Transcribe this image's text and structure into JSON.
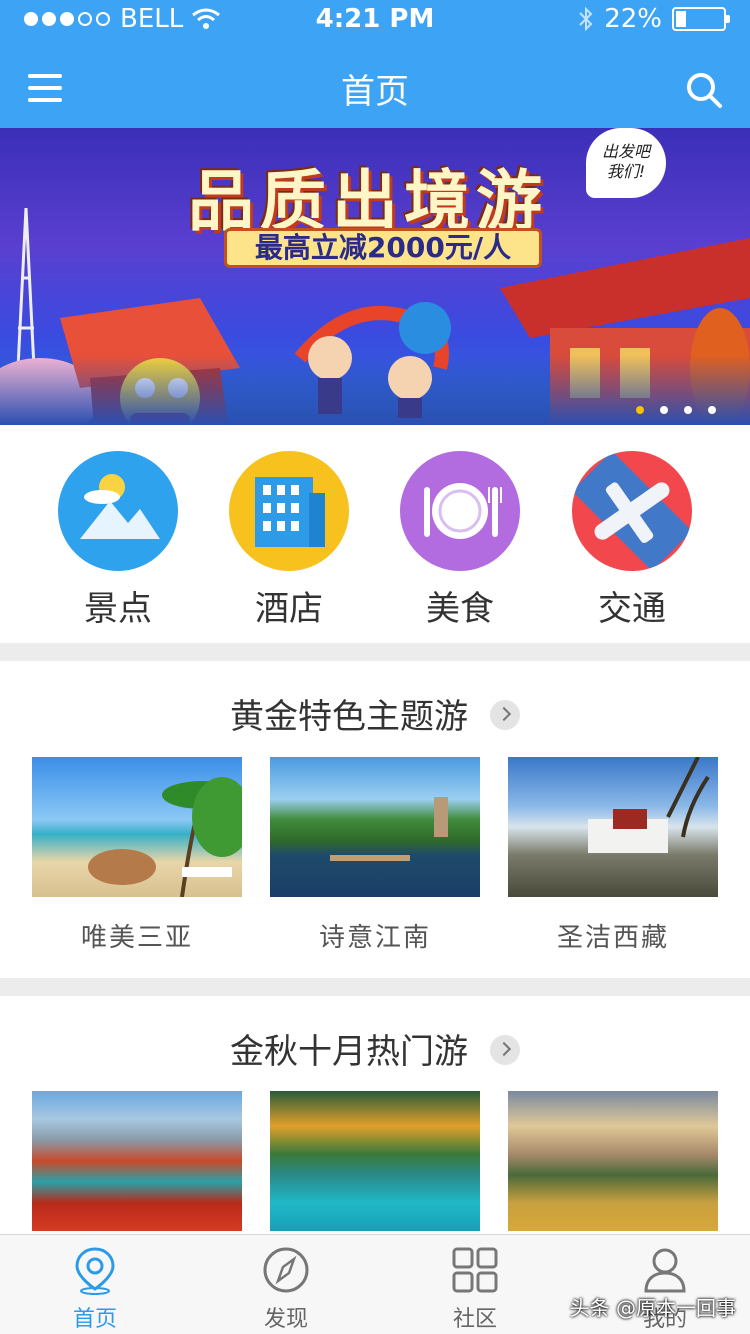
{
  "status_bar": {
    "carrier": "BELL",
    "time": "4:21 PM",
    "battery": "22%",
    "battery_level": 0.22
  },
  "nav": {
    "title": "首页"
  },
  "banner": {
    "title": "品质出境游",
    "subtitle": "最高立减2000元/人",
    "bubble_line1": "出发吧",
    "bubble_line2": "我们!",
    "page_count": 4,
    "active_page": 1
  },
  "categories": [
    {
      "label": "景点",
      "icon": "mountain-icon",
      "color": "#2fa2ee"
    },
    {
      "label": "酒店",
      "icon": "hotel-building-icon",
      "color": "#f7c21e"
    },
    {
      "label": "美食",
      "icon": "plate-cutlery-icon",
      "color": "#b36be0"
    },
    {
      "label": "交通",
      "icon": "airplane-icon",
      "color": "#f2484d"
    }
  ],
  "sections": [
    {
      "title": "黄金特色主题游",
      "items": [
        {
          "caption": "唯美三亚"
        },
        {
          "caption": "诗意江南"
        },
        {
          "caption": "圣洁西藏"
        }
      ]
    },
    {
      "title": "金秋十月热门游",
      "items": [
        {
          "caption": ""
        },
        {
          "caption": ""
        },
        {
          "caption": ""
        }
      ]
    }
  ],
  "tabbar": [
    {
      "label": "首页",
      "icon": "location-pin-icon",
      "active": true
    },
    {
      "label": "发现",
      "icon": "compass-icon",
      "active": false
    },
    {
      "label": "社区",
      "icon": "grid-icon",
      "active": false
    },
    {
      "label": "我的",
      "icon": "person-icon",
      "active": false
    }
  ],
  "watermark": "头条 @原本一回事",
  "colors": {
    "primary": "#3da4f5",
    "tab_active": "#2d9ae8"
  }
}
